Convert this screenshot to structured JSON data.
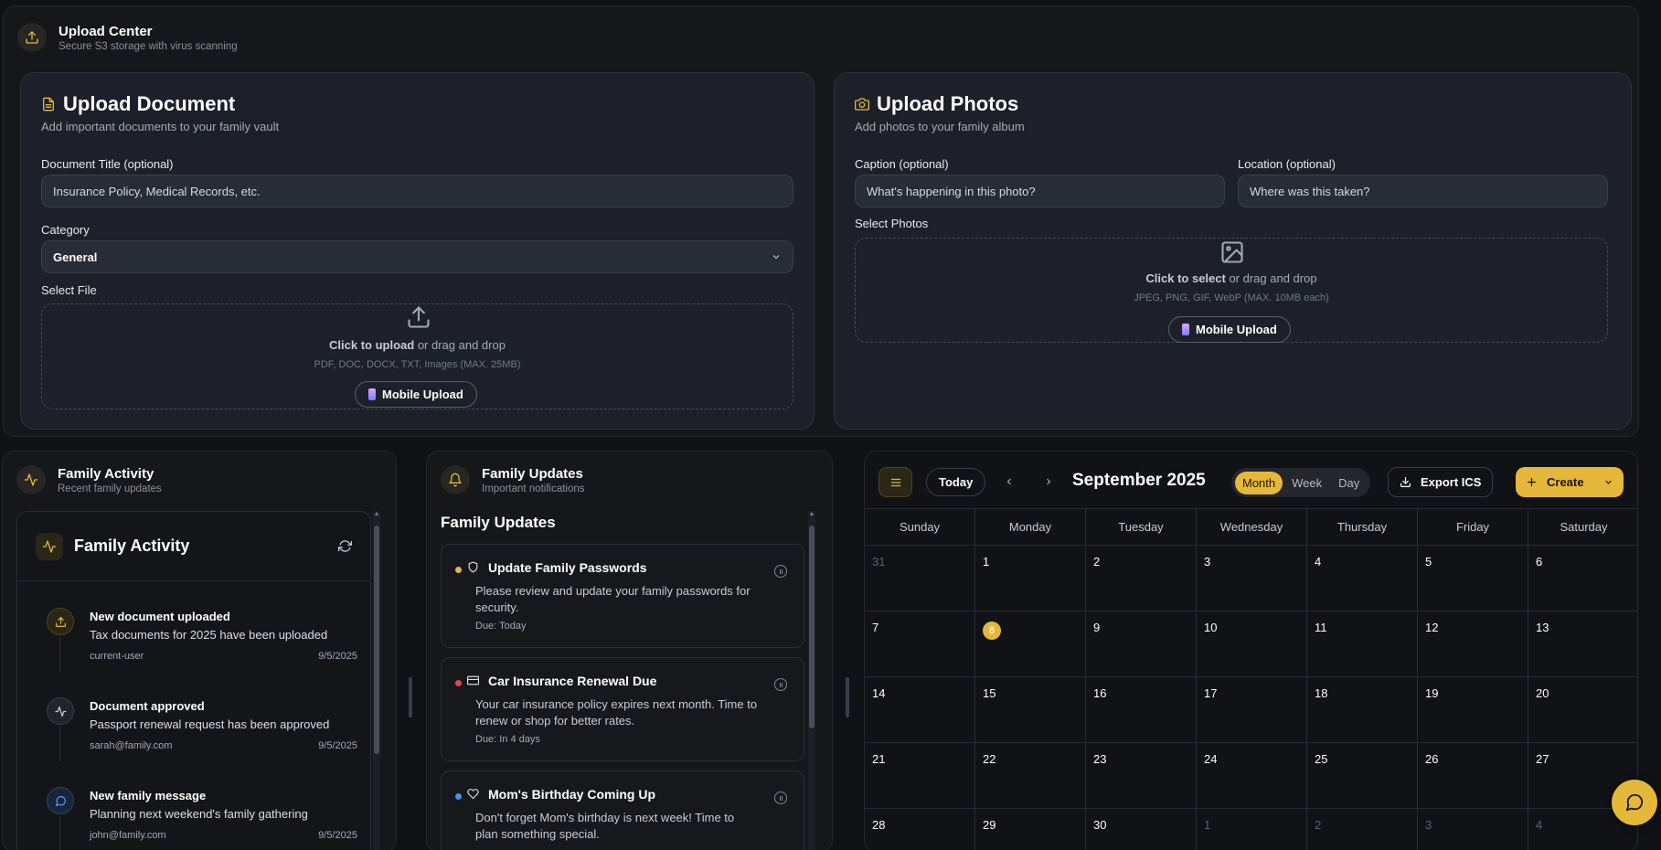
{
  "upload_center": {
    "title": "Upload Center",
    "subtitle": "Secure S3 storage with virus scanning"
  },
  "upload_document": {
    "title": "Upload Document",
    "description": "Add important documents to your family vault",
    "title_label": "Document Title (optional)",
    "title_placeholder": "Insurance Policy, Medical Records, etc.",
    "category_label": "Category",
    "category_value": "General",
    "file_label": "Select File",
    "drop_strong": "Click to upload",
    "drop_rest": " or drag and drop",
    "drop_hint": "PDF, DOC, DOCX, TXT, Images (MAX. 25MB)",
    "mobile_upload": "Mobile Upload"
  },
  "upload_photos": {
    "title": "Upload Photos",
    "description": "Add photos to your family album",
    "caption_label": "Caption (optional)",
    "caption_placeholder": "What's happening in this photo?",
    "location_label": "Location (optional)",
    "location_placeholder": "Where was this taken?",
    "select_label": "Select Photos",
    "drop_strong": "Click to select",
    "drop_rest": " or drag and drop",
    "drop_hint": "JPEG, PNG, GIF, WebP (MAX. 10MB each)",
    "mobile_upload": "Mobile Upload"
  },
  "family_activity": {
    "panel_title": "Family Activity",
    "panel_subtitle": "Recent family updates",
    "inner_title": "Family Activity",
    "items": [
      {
        "title": "New document uploaded",
        "desc": "Tax documents for 2025 have been uploaded",
        "user": "current-user",
        "date": "9/5/2025"
      },
      {
        "title": "Document approved",
        "desc": "Passport renewal request has been approved",
        "user": "sarah@family.com",
        "date": "9/5/2025"
      },
      {
        "title": "New family message",
        "desc": "Planning next weekend's family gathering",
        "user": "john@family.com",
        "date": "9/5/2025"
      }
    ]
  },
  "family_updates": {
    "panel_title": "Family Updates",
    "panel_subtitle": "Important notifications",
    "heading": "Family Updates",
    "items": [
      {
        "title": "Update Family Passwords",
        "desc": "Please review and update your family passwords for security.",
        "due": "Due: Today",
        "color": "#e5b83a"
      },
      {
        "title": "Car Insurance Renewal Due",
        "desc": "Your car insurance policy expires next month. Time to renew or shop for better rates.",
        "due": "Due: In 4 days",
        "color": "#e04848"
      },
      {
        "title": "Mom's Birthday Coming Up",
        "desc": "Don't forget Mom's birthday is next week! Time to plan something special.",
        "due": "",
        "color": "#4a8ef0"
      }
    ]
  },
  "calendar": {
    "today": "Today",
    "month": "September 2025",
    "views": [
      "Month",
      "Week",
      "Day"
    ],
    "active_view": "Month",
    "export": "Export ICS",
    "create": "Create",
    "weekdays": [
      "Sunday",
      "Monday",
      "Tuesday",
      "Wednesday",
      "Thursday",
      "Friday",
      "Saturday"
    ],
    "weeks": [
      [
        "31",
        "1",
        "2",
        "3",
        "4",
        "5",
        "6"
      ],
      [
        "7",
        "8",
        "9",
        "10",
        "11",
        "12",
        "13"
      ],
      [
        "14",
        "15",
        "16",
        "17",
        "18",
        "19",
        "20"
      ],
      [
        "21",
        "22",
        "23",
        "24",
        "25",
        "26",
        "27"
      ],
      [
        "28",
        "29",
        "30",
        "1",
        "2",
        "3",
        "4"
      ]
    ],
    "current_day": "8",
    "accent": "#e5b83a"
  }
}
